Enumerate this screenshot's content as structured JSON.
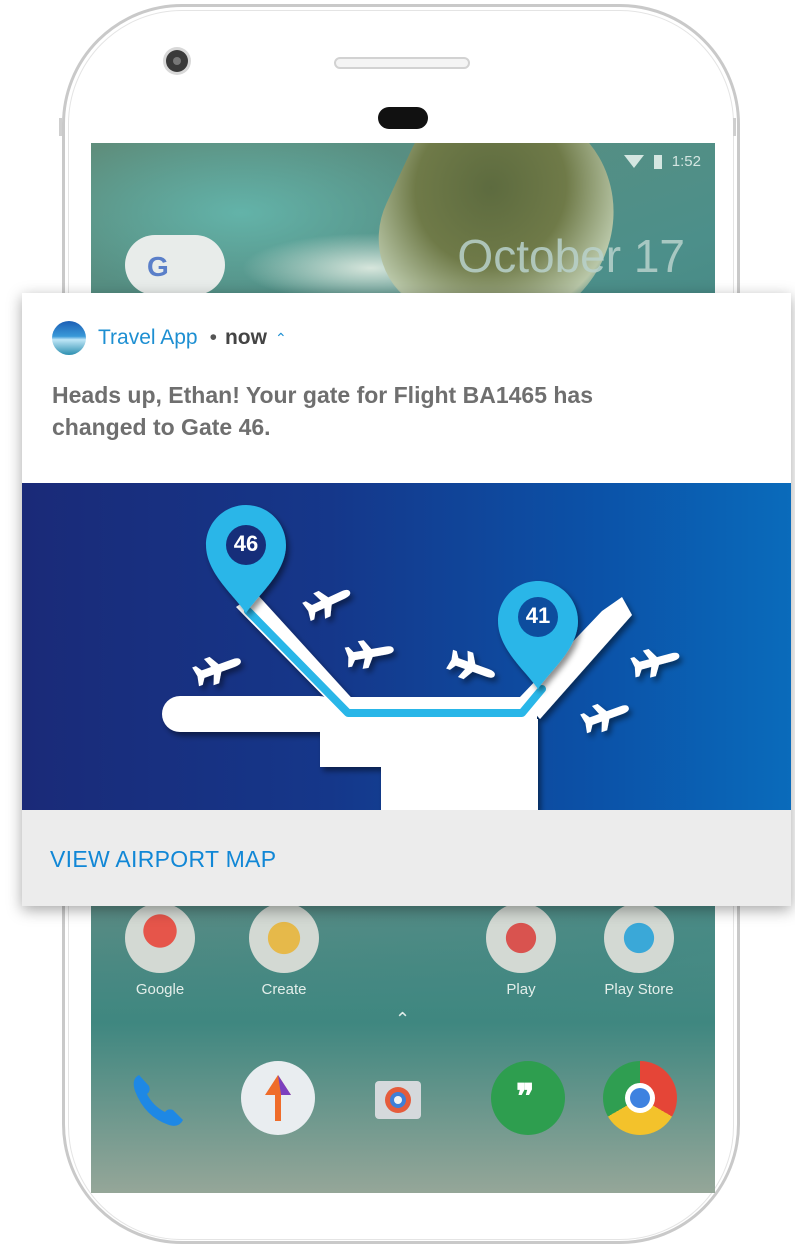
{
  "statusbar": {
    "time": "1:52"
  },
  "lockscreen": {
    "date": "October 17"
  },
  "search_widget": {
    "letter": "G"
  },
  "home_apps": [
    {
      "label": "Google",
      "icon": "google-apps-folder-icon"
    },
    {
      "label": "Create",
      "icon": "create-folder-icon"
    },
    {
      "label": "Play",
      "icon": "play-folder-icon"
    },
    {
      "label": "Play Store",
      "icon": "play-store-icon"
    }
  ],
  "dock": [
    {
      "icon": "phone-icon"
    },
    {
      "icon": "direction-app-icon"
    },
    {
      "icon": "camera-icon"
    },
    {
      "icon": "hangouts-icon"
    },
    {
      "icon": "chrome-icon"
    }
  ],
  "dock_hangouts_glyph": "❞",
  "notification": {
    "app_name": "Travel App",
    "separator": "•",
    "time": "now",
    "expand_chevron": "^",
    "message": "Heads up, Ethan! Your gate for Flight BA1465 has changed to Gate 46.",
    "image": {
      "new_gate": "46",
      "old_gate": "41",
      "colors": {
        "bg_left": "#1a2a78",
        "bg_right": "#0a6bbb",
        "pin": "#29b6e8",
        "route": "#29b6e8"
      }
    },
    "action_label": "VIEW AIRPORT MAP"
  },
  "colors": {
    "accent": "#1187d6",
    "frame": "#c9c9c9"
  }
}
